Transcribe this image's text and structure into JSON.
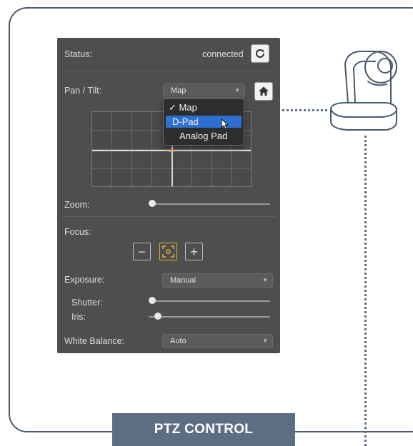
{
  "caption": "PTZ CONTROL",
  "status": {
    "label": "Status:",
    "value": "connected",
    "refresh_icon": "refresh-icon"
  },
  "pan_tilt": {
    "label": "Pan / Tilt:",
    "mode_selected": "Map",
    "home_icon": "home-icon",
    "menu": [
      {
        "label": "Map",
        "checked": true,
        "highlighted": false
      },
      {
        "label": "D-Pad",
        "checked": false,
        "highlighted": true
      },
      {
        "label": "Analog Pad",
        "checked": false,
        "highlighted": false
      }
    ],
    "checkmark": "✓"
  },
  "zoom": {
    "label": "Zoom:",
    "level": 0
  },
  "focus": {
    "label": "Focus:",
    "minus": "−",
    "plus": "+",
    "auto_icon": "autofocus-icon"
  },
  "exposure": {
    "label": "Exposure:",
    "mode": "Manual",
    "shutter_label": "Shutter:",
    "shutter_level": 0,
    "iris_label": "Iris:",
    "iris_level": 0.05
  },
  "white_balance": {
    "label": "White Balance:",
    "mode": "Auto"
  },
  "colors": {
    "panel": "#4e4e4e",
    "frame": "#4b5a6e",
    "caption_bg": "#5d6d83",
    "menu_highlight": "#2f6fd1",
    "focus_accent": "#e2b03a"
  }
}
